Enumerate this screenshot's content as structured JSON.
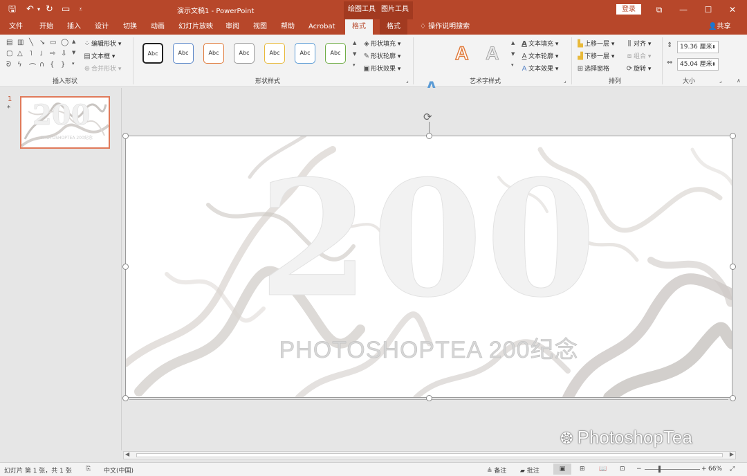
{
  "titlebar": {
    "document_title": "演示文稿1 - PowerPoint",
    "context_tab_drawing": "绘图工具",
    "context_tab_picture": "图片工具",
    "login_label": "登录"
  },
  "tabs": [
    "文件",
    "开始",
    "插入",
    "设计",
    "切换",
    "动画",
    "幻灯片放映",
    "审阅",
    "视图",
    "帮助",
    "Acrobat",
    "格式",
    "格式"
  ],
  "tell_me": "操作说明搜索",
  "share_label": "共享",
  "ribbon": {
    "insert_shapes": {
      "edit_shape": "编辑形状",
      "text_box": "文本框",
      "merge_shapes": "合并形状",
      "label": "插入形状"
    },
    "shape_styles": {
      "style_label": "Abc",
      "fill": "形状填充",
      "outline": "形状轮廓",
      "effects": "形状效果",
      "label": "形状样式"
    },
    "wordart": {
      "letter": "A",
      "text_fill": "文本填充",
      "text_outline": "文本轮廓",
      "text_effects": "文本效果",
      "label": "艺术字样式"
    },
    "arrange": {
      "bring_forward": "上移一层",
      "send_backward": "下移一层",
      "selection_pane": "选择窗格",
      "align": "对齐",
      "group": "组合",
      "rotate": "旋转",
      "label": "排列"
    },
    "size": {
      "height": "19.36 厘米",
      "width": "45.04 厘米",
      "label": "大小"
    }
  },
  "thumbnail": {
    "number": "1",
    "star": "*"
  },
  "slide": {
    "big_text": "200",
    "subtitle": "PHOTOSHOPTEA 200纪念"
  },
  "watermark": "PhotoshopTea",
  "status": {
    "slide_info": "幻灯片 第 1 张，共 1 张",
    "language": "中文(中国)",
    "notes": "备注",
    "comments": "批注",
    "zoom": "66%"
  },
  "colors": {
    "accent": "#b7472a",
    "context_tab": "#a23a20",
    "ribbon_bg": "#f3f3f3"
  }
}
